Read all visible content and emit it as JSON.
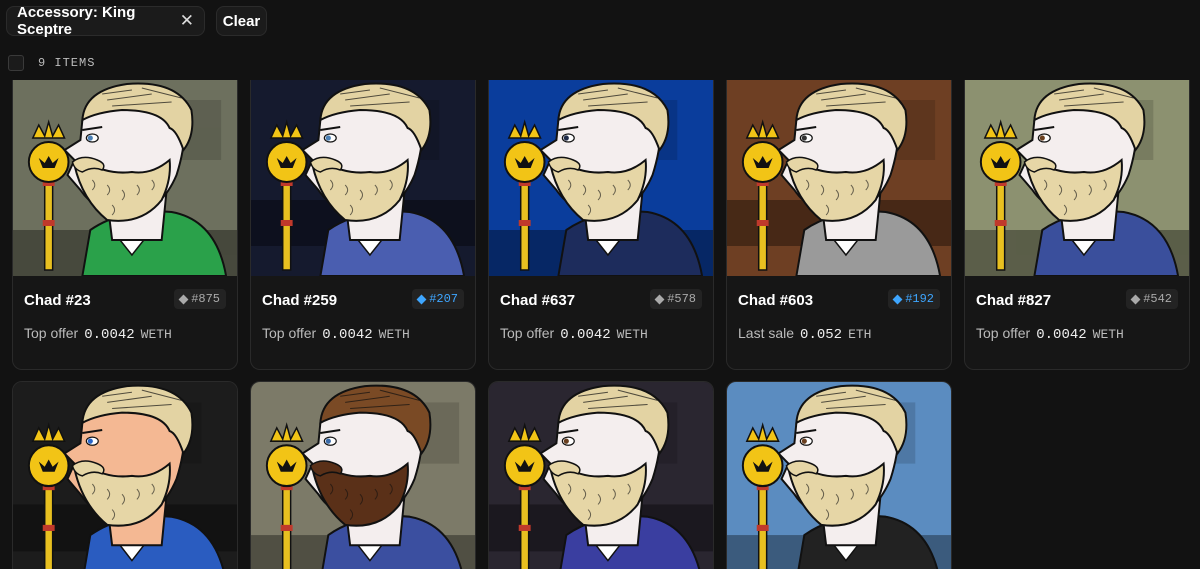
{
  "filters": {
    "active_filter": "Accessory: King Sceptre",
    "clear_label": "Clear"
  },
  "results": {
    "count_label": "9 ITEMS"
  },
  "items": [
    {
      "name": "Chad #23",
      "rank": "#875",
      "rank_color": "#aaaaaa",
      "price_label": "Top offer",
      "price_value": "0.0042",
      "currency": "WETH",
      "bg": "#6d705e",
      "shirt": "#2aa14a",
      "beard": "#e6d6a6",
      "skin": "#f4eeee",
      "eye": "#4a7fb5"
    },
    {
      "name": "Chad #259",
      "rank": "#207",
      "rank_color": "#3ea6ff",
      "price_label": "Top offer",
      "price_value": "0.0042",
      "currency": "WETH",
      "bg": "#151a2e",
      "shirt": "#4a5eb0",
      "beard": "#e6d6a6",
      "skin": "#f4eeee",
      "eye": "#4a7fb5"
    },
    {
      "name": "Chad #637",
      "rank": "#578",
      "rank_color": "#aaaaaa",
      "price_label": "Top offer",
      "price_value": "0.0042",
      "currency": "WETH",
      "bg": "#0a3d9c",
      "shirt": "#1d2c5c",
      "beard": "#e6d6a6",
      "skin": "#f4eeee",
      "eye": "#1e2a48"
    },
    {
      "name": "Chad #603",
      "rank": "#192",
      "rank_color": "#3ea6ff",
      "price_label": "Last sale",
      "price_value": "0.052",
      "currency": "ETH",
      "bg": "#6e3f23",
      "shirt": "#9a9a9a",
      "beard": "#e6d6a6",
      "skin": "#f4eeee",
      "eye": "#333333"
    },
    {
      "name": "Chad #827",
      "rank": "#542",
      "rank_color": "#aaaaaa",
      "price_label": "Top offer",
      "price_value": "0.0042",
      "currency": "WETH",
      "bg": "#8c9170",
      "shirt": "#3a4f9c",
      "beard": "#e6d6a6",
      "skin": "#f4eeee",
      "eye": "#6a4020"
    },
    {
      "name": "",
      "rank": "",
      "price_label": "",
      "price_value": "",
      "currency": "",
      "bg": "#1c1c1c",
      "shirt": "#2a5cc0",
      "beard": "#e6d6a6",
      "skin": "#f4b893",
      "eye": "#2a66c8"
    },
    {
      "name": "",
      "rank": "",
      "price_label": "",
      "price_value": "",
      "currency": "",
      "bg": "#7c7a68",
      "shirt": "#3b4fa0",
      "beard": "#5a3018",
      "skin": "#f4eeee",
      "eye": "#3a6aa8"
    },
    {
      "name": "",
      "rank": "",
      "price_label": "",
      "price_value": "",
      "currency": "",
      "bg": "#2a2630",
      "shirt": "#3a3ea0",
      "beard": "#e6d6a6",
      "skin": "#f4eeee",
      "eye": "#6a4020"
    },
    {
      "name": "",
      "rank": "",
      "price_label": "",
      "price_value": "",
      "currency": "",
      "bg": "#5b8cc0",
      "shirt": "#222222",
      "beard": "#e6d6a6",
      "skin": "#f4eeee",
      "eye": "#6a4020"
    }
  ]
}
